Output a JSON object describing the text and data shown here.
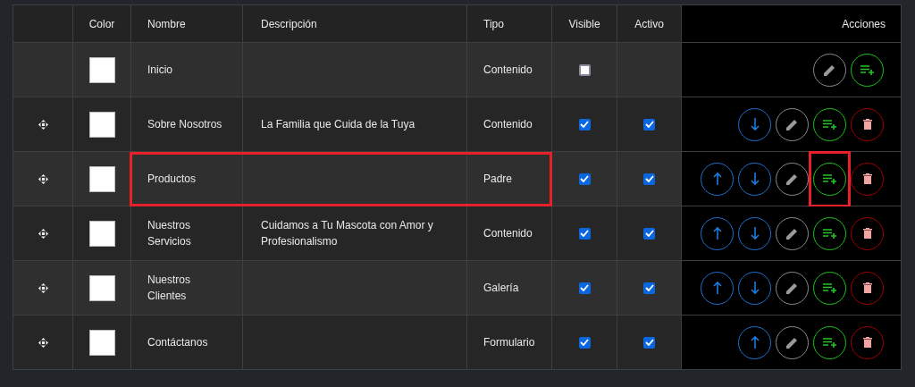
{
  "columns": [
    "Color",
    "Nombre",
    "Descripción",
    "Tipo",
    "Visible",
    "Activo",
    "Acciones"
  ],
  "rows": [
    {
      "draggable": false,
      "color": "#ffffff",
      "name": "Inicio",
      "description": "",
      "type": "Contenido",
      "visible": false,
      "highlighted": false,
      "actions": [
        {
          "kind": "edit",
          "highlighted": false
        },
        {
          "kind": "add",
          "highlighted": false
        }
      ]
    },
    {
      "draggable": true,
      "color": "#ffffff",
      "name": "Sobre Nosotros",
      "description": "La Familia que Cuida de la Tuya",
      "type": "Contenido",
      "visible": true,
      "active": true,
      "highlighted": false,
      "actions": [
        {
          "kind": "down",
          "highlighted": false
        },
        {
          "kind": "edit",
          "highlighted": false
        },
        {
          "kind": "add",
          "highlighted": false
        },
        {
          "kind": "delete",
          "highlighted": false
        }
      ]
    },
    {
      "draggable": true,
      "color": "#ffffff",
      "name": "Productos",
      "description": "",
      "type": "Padre",
      "visible": true,
      "active": true,
      "highlighted": true,
      "actions": [
        {
          "kind": "up",
          "highlighted": false
        },
        {
          "kind": "down",
          "highlighted": false
        },
        {
          "kind": "edit",
          "highlighted": false
        },
        {
          "kind": "add",
          "highlighted": true
        },
        {
          "kind": "delete",
          "highlighted": false
        }
      ]
    },
    {
      "draggable": true,
      "color": "#ffffff",
      "name": "Nuestros Servicios",
      "description": "Cuidamos a Tu Mascota con Amor y Profesionalismo",
      "type": "Contenido",
      "visible": true,
      "active": true,
      "highlighted": false,
      "actions": [
        {
          "kind": "up",
          "highlighted": false
        },
        {
          "kind": "down",
          "highlighted": false
        },
        {
          "kind": "edit",
          "highlighted": false
        },
        {
          "kind": "add",
          "highlighted": false
        },
        {
          "kind": "delete",
          "highlighted": false
        }
      ]
    },
    {
      "draggable": true,
      "color": "#ffffff",
      "name": "Nuestros Clientes",
      "description": "",
      "type": "Galería",
      "visible": true,
      "active": true,
      "highlighted": false,
      "actions": [
        {
          "kind": "up",
          "highlighted": false
        },
        {
          "kind": "down",
          "highlighted": false
        },
        {
          "kind": "edit",
          "highlighted": false
        },
        {
          "kind": "add",
          "highlighted": false
        },
        {
          "kind": "delete",
          "highlighted": false
        }
      ]
    },
    {
      "draggable": true,
      "color": "#ffffff",
      "name": "Contáctanos",
      "description": "",
      "type": "Formulario",
      "visible": true,
      "active": true,
      "highlighted": false,
      "actions": [
        {
          "kind": "up",
          "highlighted": false
        },
        {
          "kind": "edit",
          "highlighted": false
        },
        {
          "kind": "add",
          "highlighted": false
        },
        {
          "kind": "delete",
          "highlighted": false
        }
      ]
    }
  ]
}
